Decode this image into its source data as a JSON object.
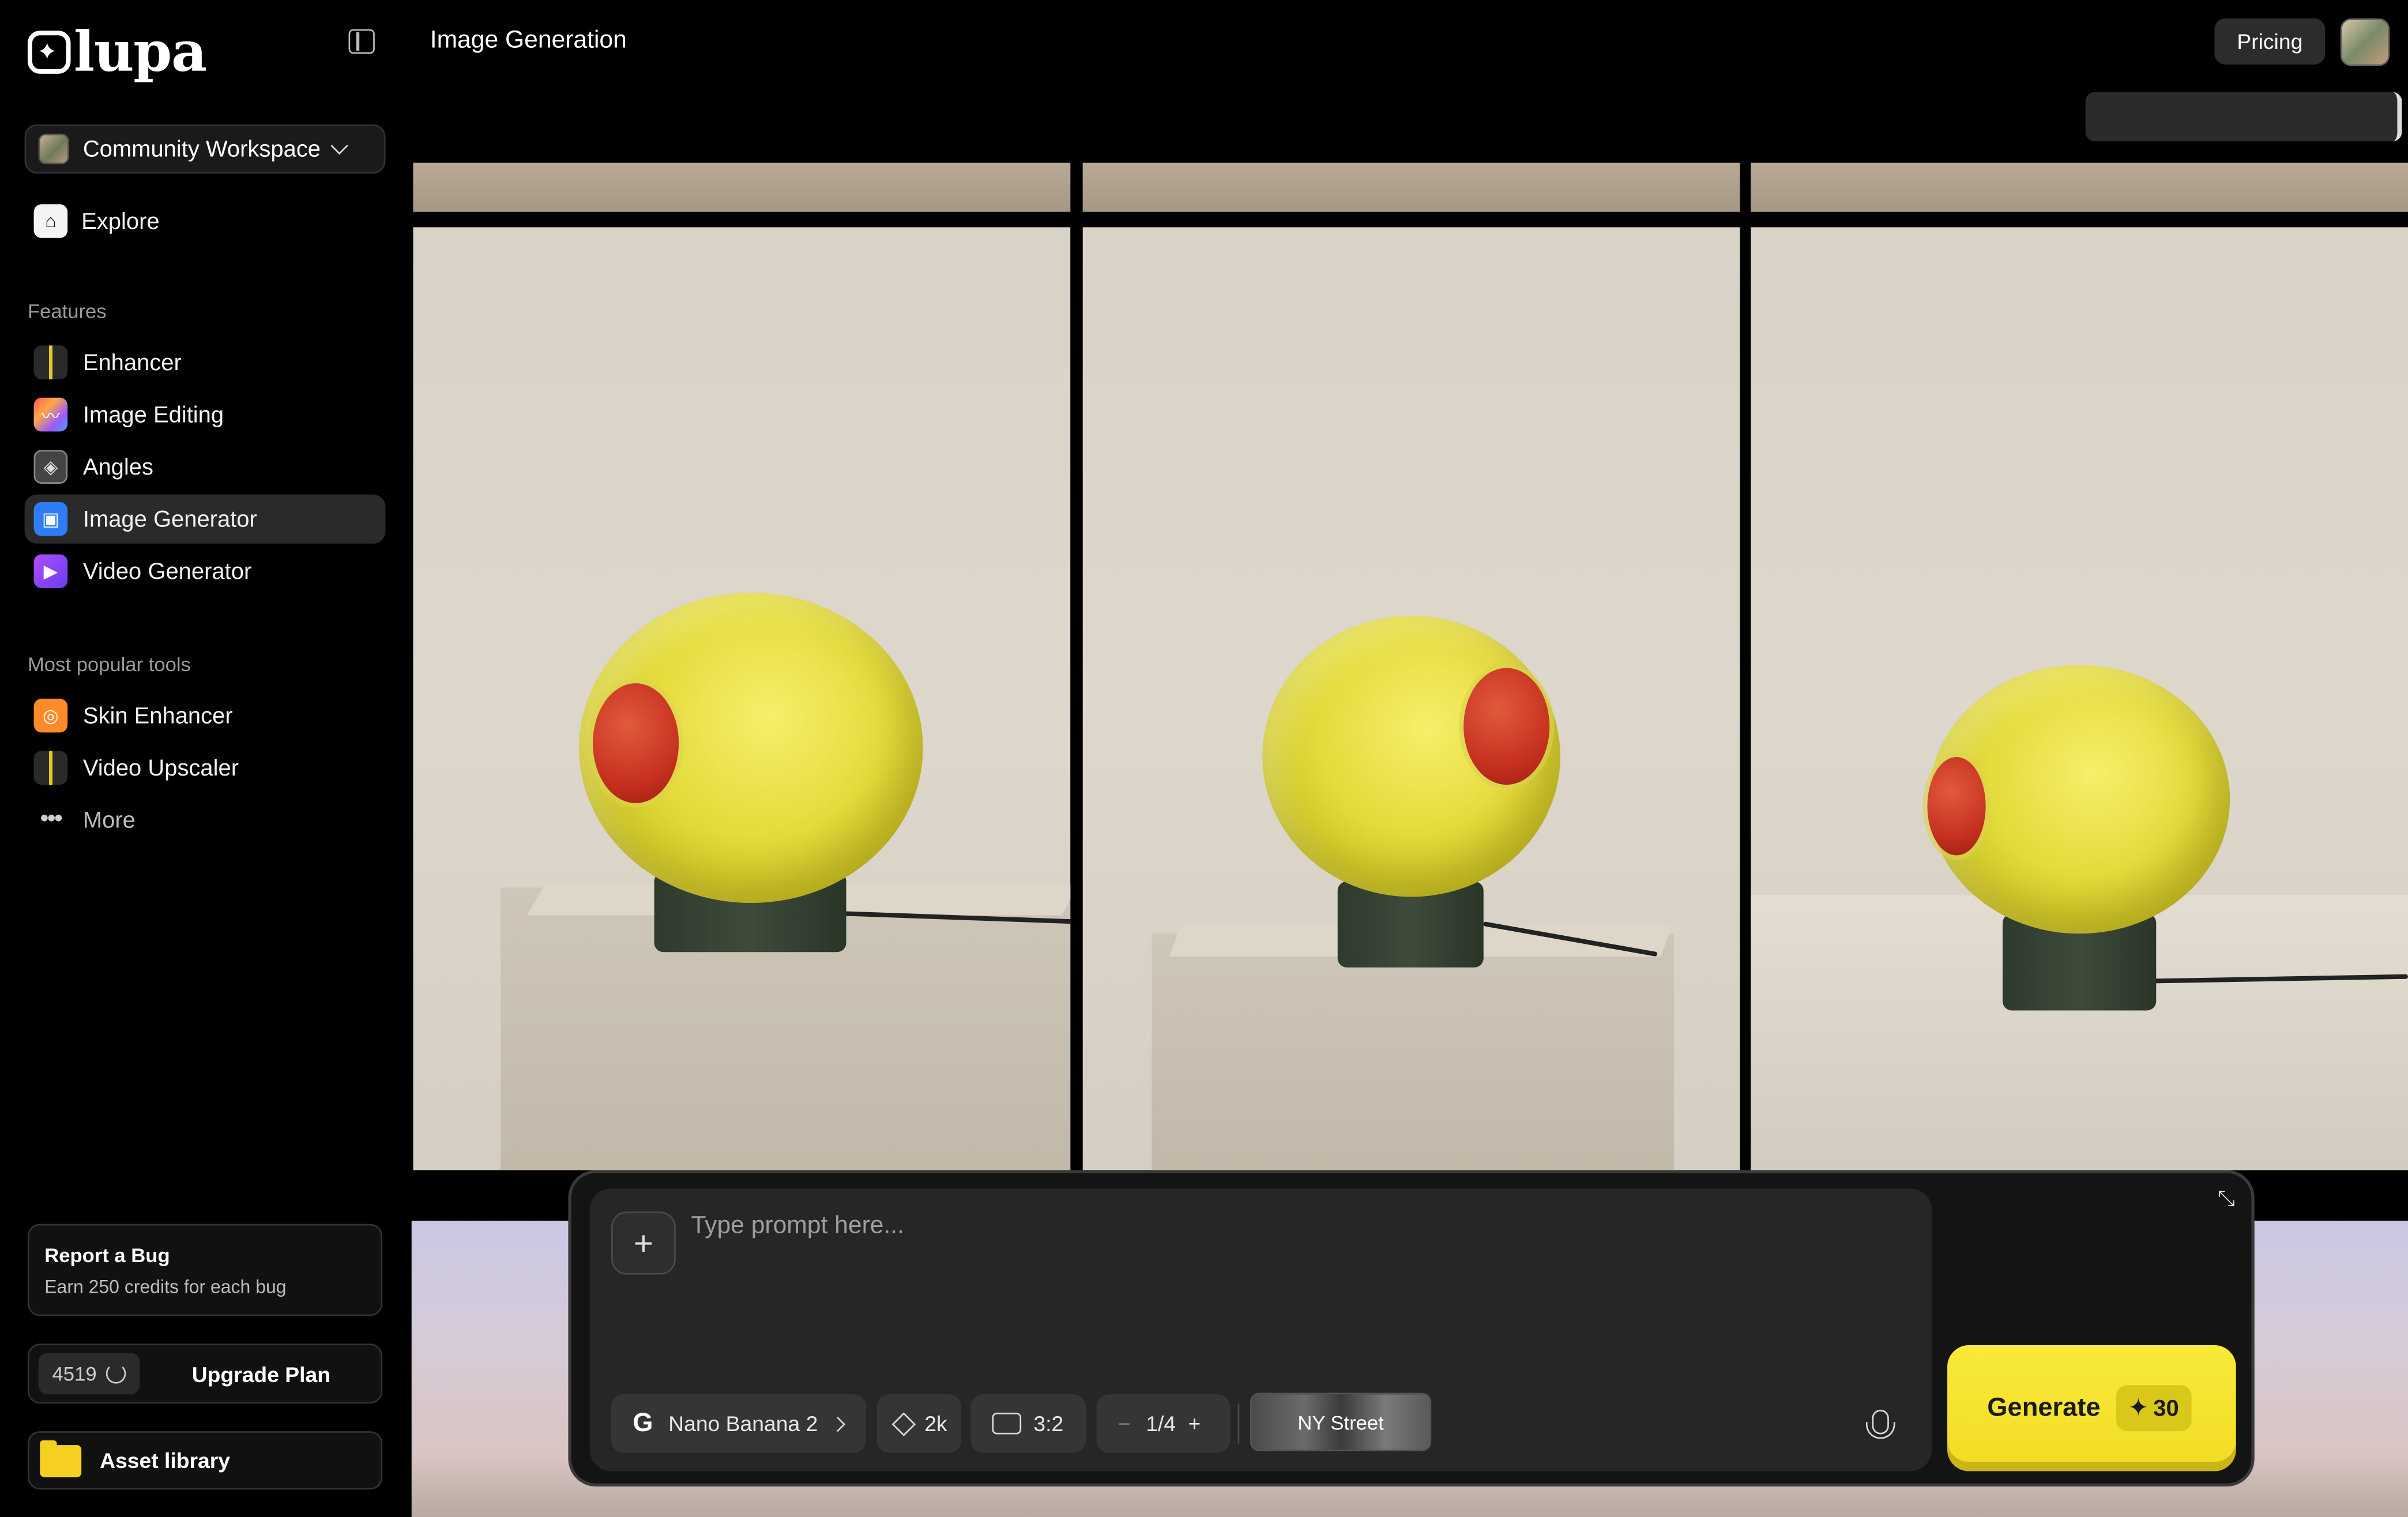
{
  "sidebar": {
    "logo": "lupa",
    "workspace": "Community Workspace",
    "explore": "Explore",
    "features_title": "Features",
    "features": [
      {
        "label": "Enhancer",
        "icon": "enhancer-icon"
      },
      {
        "label": "Image Editing",
        "icon": "image-editing-icon"
      },
      {
        "label": "Angles",
        "icon": "angles-icon"
      },
      {
        "label": "Image Generator",
        "icon": "image-generator-icon",
        "active": true
      },
      {
        "label": "Video Generator",
        "icon": "video-generator-icon"
      }
    ],
    "popular_title": "Most popular tools",
    "popular": [
      {
        "label": "Skin Enhancer",
        "icon": "skin-enhancer-icon"
      },
      {
        "label": "Video Upscaler",
        "icon": "video-upscaler-icon"
      },
      {
        "label": "More",
        "icon": "more-dots-icon"
      }
    ],
    "bug": {
      "title": "Report a Bug",
      "subtitle": "Earn 250 credits for each bug"
    },
    "credits": "4519",
    "upgrade": "Upgrade Plan",
    "asset_library": "Asset library"
  },
  "header": {
    "title": "Image Generation",
    "pricing": "Pricing"
  },
  "prompt": {
    "placeholder": "Type prompt here...",
    "model": "Nano Banana 2",
    "resolution": "2k",
    "aspect": "3:2",
    "count": "1/4",
    "style": "NY Street",
    "generate": "Generate",
    "cost": "30"
  },
  "colors": {
    "accent": "#f2dc24",
    "active_nav": "#2a2a2a",
    "background": "#000000"
  }
}
